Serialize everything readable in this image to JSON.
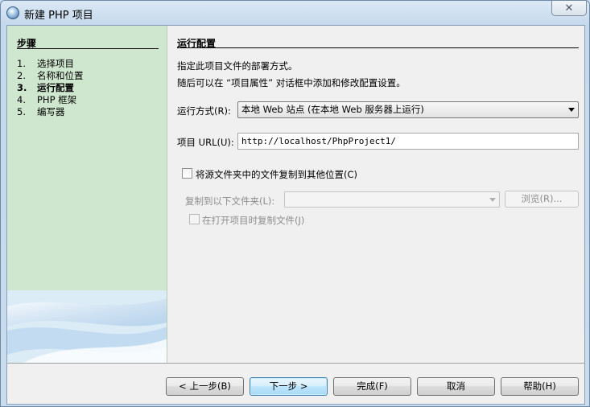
{
  "window": {
    "title": "新建 PHP 项目",
    "close_label": "✕"
  },
  "steps": {
    "title": "步骤",
    "items": [
      {
        "num": "1.",
        "label": "选择项目",
        "current": false
      },
      {
        "num": "2.",
        "label": "名称和位置",
        "current": false
      },
      {
        "num": "3.",
        "label": "运行配置",
        "current": true
      },
      {
        "num": "4.",
        "label": "PHP 框架",
        "current": false
      },
      {
        "num": "5.",
        "label": "编写器",
        "current": false
      }
    ]
  },
  "content": {
    "title": "运行配置",
    "description_line1": "指定此项目文件的部署方式。",
    "description_line2": "随后可以在 “项目属性” 对话框中添加和修改配置设置。",
    "run_as_label": "运行方式(R):",
    "run_as_value": "本地 Web 站点 (在本地 Web 服务器上运行)",
    "url_label": "项目 URL(U):",
    "url_value": "http://localhost/PhpProject1/",
    "copy_checkbox_label": "将源文件夹中的文件复制到其他位置(C)",
    "copy_checked": false,
    "copy_to_label": "复制到以下文件夹(L):",
    "copy_to_value": "",
    "browse_label": "浏览(R)...",
    "copy_on_open_label": "在打开项目时复制文件(J)",
    "copy_on_open_checked": false
  },
  "footer": {
    "back_label": "< 上一步(B)",
    "next_label": "下一步 >",
    "finish_label": "完成(F)",
    "cancel_label": "取消",
    "help_label": "帮助(H)"
  },
  "colors": {
    "steps_panel_bg": "#cfe6cf",
    "default_button_border": "#3c7fb1",
    "window_chrome": "#c9dcee"
  }
}
